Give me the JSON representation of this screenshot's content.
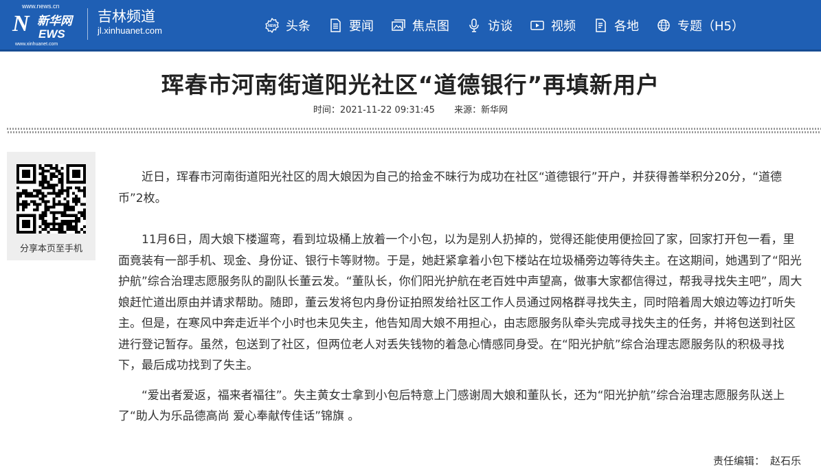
{
  "header": {
    "logo": {
      "url_top": "www.news.cn",
      "mark": "N",
      "cn": "新华网",
      "news": "EWS",
      "url_bottom": "www.xinhuanet.com"
    },
    "channel_name": "吉林频道",
    "channel_domain": "jl.xinhuanet.com",
    "nav": [
      {
        "label": "头条",
        "icon": "news-badge-icon"
      },
      {
        "label": "要闻",
        "icon": "document-icon"
      },
      {
        "label": "焦点图",
        "icon": "gallery-icon"
      },
      {
        "label": "访谈",
        "icon": "microphone-icon"
      },
      {
        "label": "视频",
        "icon": "video-icon"
      },
      {
        "label": "各地",
        "icon": "location-doc-icon"
      },
      {
        "label": "专题（H5）",
        "icon": "globe-icon"
      }
    ],
    "colors": {
      "background": "#1f5fb4"
    }
  },
  "article": {
    "title": "珲春市河南街道阳光社区“道德银行”再填新用户",
    "time_label": "时间：",
    "time": "2021-11-22 09:31:45",
    "source_label": "来源：",
    "source": "新华网",
    "paragraphs": [
      "近日，珲春市河南街道阳光社区的周大娘因为自己的拾金不昧行为成功在社区“道德银行”开户，并获得善举积分20分，“道德币”2枚。",
      "11月6日，周大娘下楼遛弯，看到垃圾桶上放着一个小包，以为是别人扔掉的，觉得还能使用便捡回了家，回家打开包一看，里面竟装有一部手机、现金、身份证、银行卡等财物。于是，她赶紧拿着小包下楼站在垃圾桶旁边等待失主。在这期间，她遇到了“阳光护航”综合治理志愿服务队的副队长董云发。“董队长，你们阳光护航在老百姓中声望高，做事大家都信得过，帮我寻找失主吧”，周大娘赶忙道出原由并请求帮助。随即，董云发将包内身份证拍照发给社区工作人员通过网格群寻找失主，同时陪着周大娘边等边打听失主。但是，在寒风中奔走近半个小时也未见失主，他告知周大娘不用担心，由志愿服务队牵头完成寻找失主的任务，并将包送到社区进行登记暂存。虽然，包送到了社区，但两位老人对丢失钱物的着急心情感同身受。在“阳光护航”综合治理志愿服务队的积极寻找下，最后成功找到了失主。",
      "“爱出者爱返，福来者福往”。失主黄女士拿到小包后特意上门感谢周大娘和董队长，还为“阳光护航”综合治理志愿服务队送上了“助人为乐品德高尚 爱心奉献传佳话”锦旗 。"
    ],
    "editor_label": "责任编辑：",
    "editor": "赵石乐"
  },
  "share": {
    "label": "分享本页至手机"
  }
}
